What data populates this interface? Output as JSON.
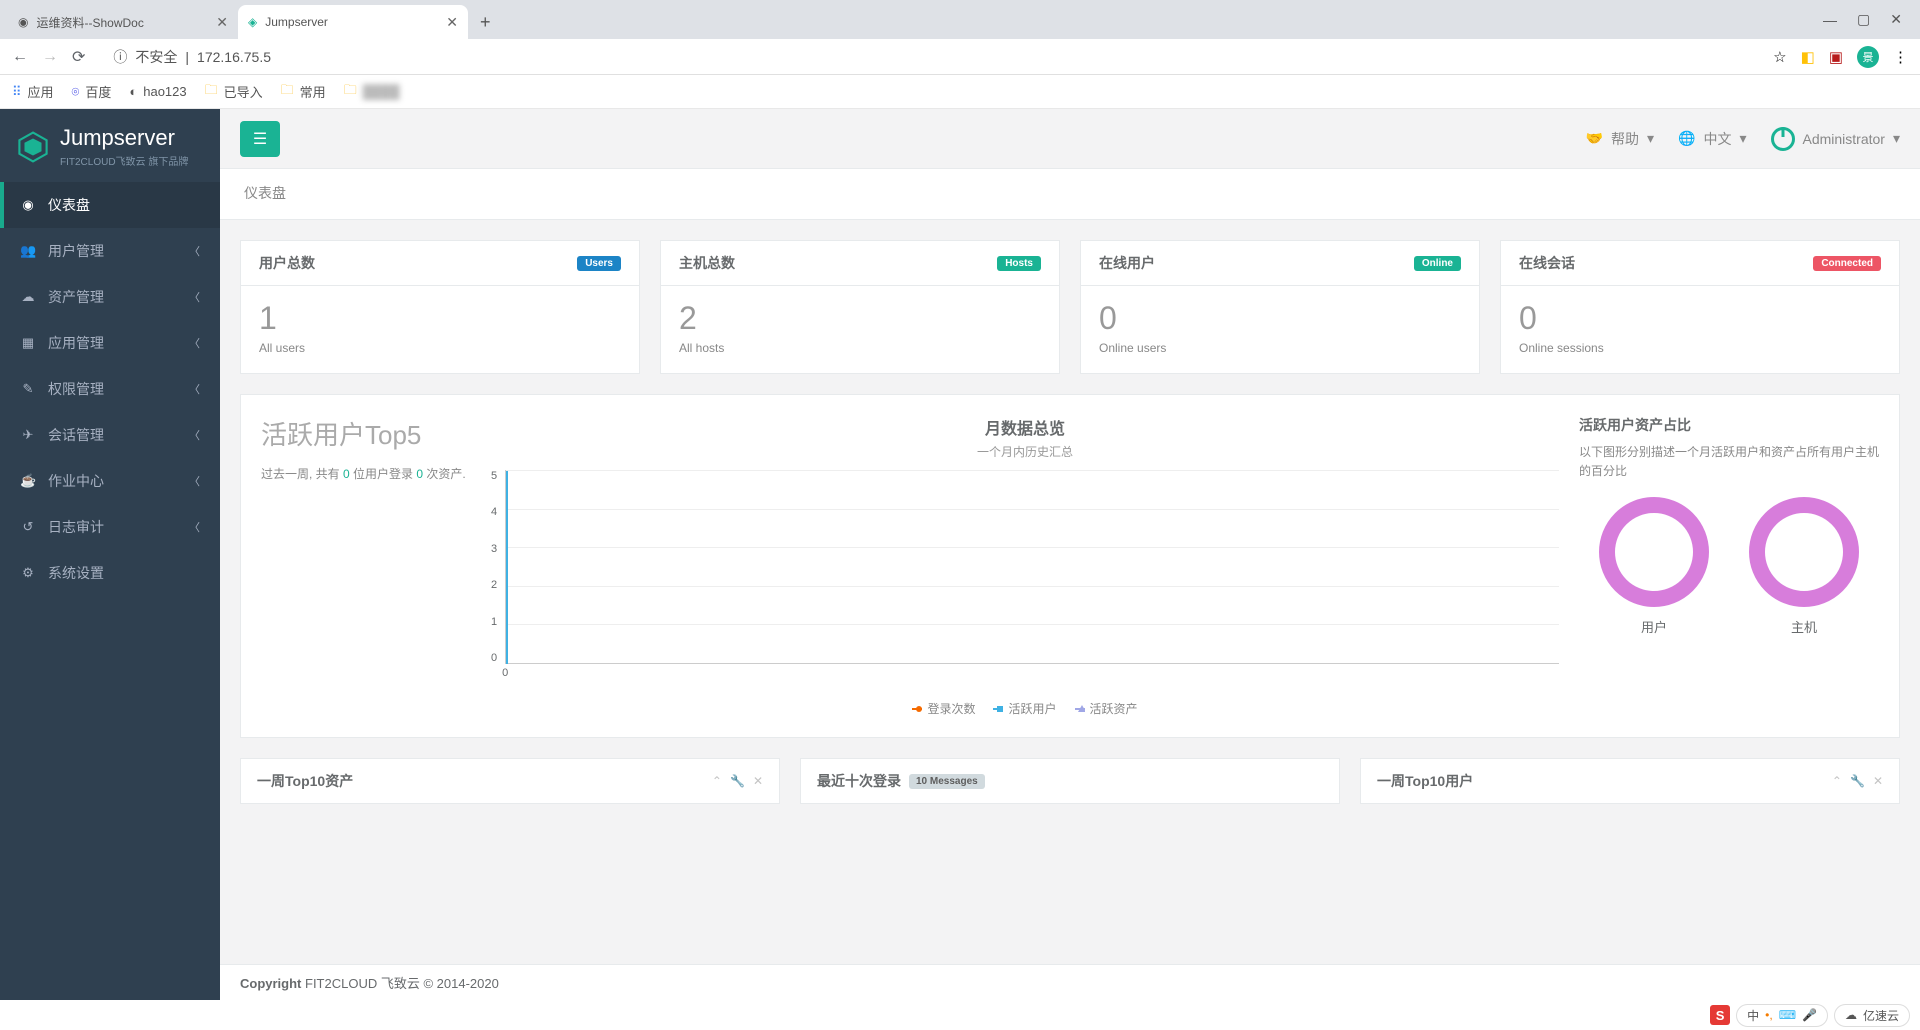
{
  "browser": {
    "tabs": [
      {
        "title": "运维资料--ShowDoc"
      },
      {
        "title": "Jumpserver"
      }
    ],
    "address": {
      "warn_icon": "ⓘ",
      "warn_text": "不安全",
      "url": "172.16.75.5"
    },
    "bookmarks_bar": {
      "apps_label": "应用",
      "items": [
        "百度",
        "hao123",
        "已导入",
        "常用"
      ]
    }
  },
  "app": {
    "brand": "Jumpserver",
    "brand_sub": "FIT2CLOUD飞致云 旗下品牌",
    "topbar": {
      "help": "帮助",
      "lang": "中文",
      "user": "Administrator"
    },
    "breadcrumb": "仪表盘",
    "sidebar": [
      {
        "icon": "◉",
        "label": "仪表盘",
        "active": true,
        "arrow": false
      },
      {
        "icon": "👥",
        "label": "用户管理",
        "active": false,
        "arrow": true
      },
      {
        "icon": "☁",
        "label": "资产管理",
        "active": false,
        "arrow": true
      },
      {
        "icon": "▦",
        "label": "应用管理",
        "active": false,
        "arrow": true
      },
      {
        "icon": "✎",
        "label": "权限管理",
        "active": false,
        "arrow": true
      },
      {
        "icon": "✈",
        "label": "会话管理",
        "active": false,
        "arrow": true
      },
      {
        "icon": "☕",
        "label": "作业中心",
        "active": false,
        "arrow": true
      },
      {
        "icon": "↺",
        "label": "日志审计",
        "active": false,
        "arrow": true
      },
      {
        "icon": "⚙",
        "label": "系统设置",
        "active": false,
        "arrow": false
      }
    ],
    "stats": [
      {
        "title": "用户总数",
        "badge": "Users",
        "cls": "b-blue",
        "value": "1",
        "sub": "All users"
      },
      {
        "title": "主机总数",
        "badge": "Hosts",
        "cls": "b-teal",
        "value": "2",
        "sub": "All hosts"
      },
      {
        "title": "在线用户",
        "badge": "Online",
        "cls": "b-green",
        "value": "0",
        "sub": "Online users"
      },
      {
        "title": "在线会话",
        "badge": "Connected",
        "cls": "b-red",
        "value": "0",
        "sub": "Online sessions"
      }
    ],
    "top5": {
      "title": "活跃用户Top5",
      "desc_a": "过去一周, 共有 ",
      "desc_n1": "0",
      "desc_b": " 位用户登录 ",
      "desc_n2": "0",
      "desc_c": " 次资产."
    },
    "monthly": {
      "title": "月数据总览",
      "sub": "一个月内历史汇总",
      "legend": [
        "登录次数",
        "活跃用户",
        "活跃资产"
      ]
    },
    "ratio": {
      "title": "活跃用户资产占比",
      "desc": "以下图形分别描述一个月活跃用户和资产占所有用户主机的百分比",
      "donuts": [
        "用户",
        "主机"
      ]
    },
    "bottom": {
      "c1": "一周Top10资产",
      "c2": "最近十次登录",
      "c2_badge": "10 Messages",
      "c3": "一周Top10用户"
    },
    "footer": {
      "bold": "Copyright",
      "text": " FIT2CLOUD 飞致云 © 2014-2020"
    },
    "taskbar": {
      "ime": "中 ",
      "brand": "亿速云"
    }
  },
  "chart_data": {
    "type": "line",
    "title": "月数据总览",
    "x": [
      0
    ],
    "series": [
      {
        "name": "登录次数",
        "values": [
          0
        ],
        "color": "#f56a00"
      },
      {
        "name": "活跃用户",
        "values": [
          0
        ],
        "color": "#3fb1e3"
      },
      {
        "name": "活跃资产",
        "values": [
          0
        ],
        "color": "#a0a7e6"
      }
    ],
    "ylim": [
      0,
      5
    ],
    "yticks": [
      0,
      1,
      2,
      3,
      4,
      5
    ],
    "xlabel": "",
    "ylabel": ""
  }
}
